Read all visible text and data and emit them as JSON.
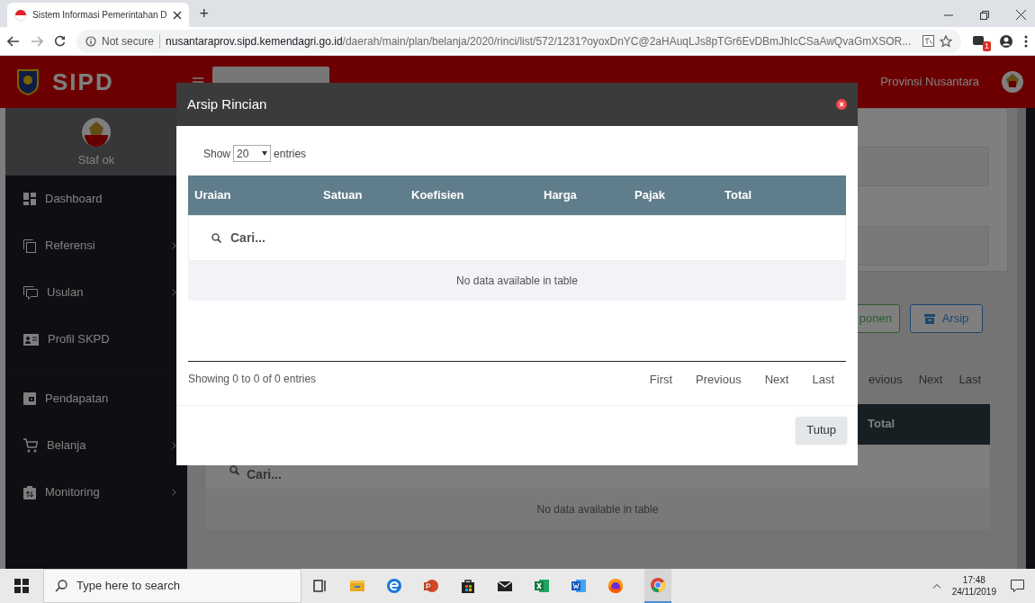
{
  "browser": {
    "tab_title": "Sistem Informasi Pemerintahan D",
    "new_tab": "+",
    "security_label": "Not secure",
    "url_host": "nusantaraprov.sipd.kemendagri.go.id",
    "url_path": "/daerah/main/plan/belanja/2020/rinci/list/572/1231?oyoxDnYC@2aHAuqLJs8pTGr6EvDBmJhIcCSaAwQvaGmXSOR...",
    "extension_badge": "1"
  },
  "header": {
    "logo_text": "SIPD",
    "region": "Provinsi Nusantara"
  },
  "sidebar": {
    "user": "Staf ok",
    "items": [
      {
        "label": "Dashboard",
        "kind": "dashboard",
        "submenu": false
      },
      {
        "label": "Referensi",
        "kind": "copy",
        "submenu": true
      },
      {
        "label": "Usulan",
        "kind": "comment",
        "submenu": true
      },
      {
        "label": "Profil SKPD",
        "kind": "card",
        "submenu": false
      },
      {
        "label": "Pendapatan",
        "kind": "wallet",
        "submenu": false
      },
      {
        "label": "Belanja",
        "kind": "cart",
        "submenu": true
      },
      {
        "label": "Monitoring",
        "kind": "clipboard",
        "submenu": true
      }
    ]
  },
  "background": {
    "buttons": [
      {
        "label": "ponen",
        "kind": "success"
      },
      {
        "label": "Arsip",
        "kind": "primary"
      }
    ],
    "pager": [
      "evious",
      "Next",
      "Last"
    ],
    "table_header": "Total",
    "search_placeholder": "Cari...",
    "empty": "No data available in table"
  },
  "modal": {
    "title": "Arsip Rincian",
    "length_before": "Show",
    "length_value": "20",
    "length_after": "entries",
    "columns": [
      "Uraian",
      "Satuan",
      "Koefisien",
      "Harga",
      "Pajak",
      "Total"
    ],
    "search_placeholder": "Cari...",
    "empty": "No data available in table",
    "info": "Showing 0 to 0 of 0 entries",
    "pager": [
      "First",
      "Previous",
      "Next",
      "Last"
    ],
    "close_button": "Tutup"
  },
  "taskbar": {
    "search_placeholder": "Type here to search",
    "time": "17:48",
    "date": "24/11/2019"
  }
}
